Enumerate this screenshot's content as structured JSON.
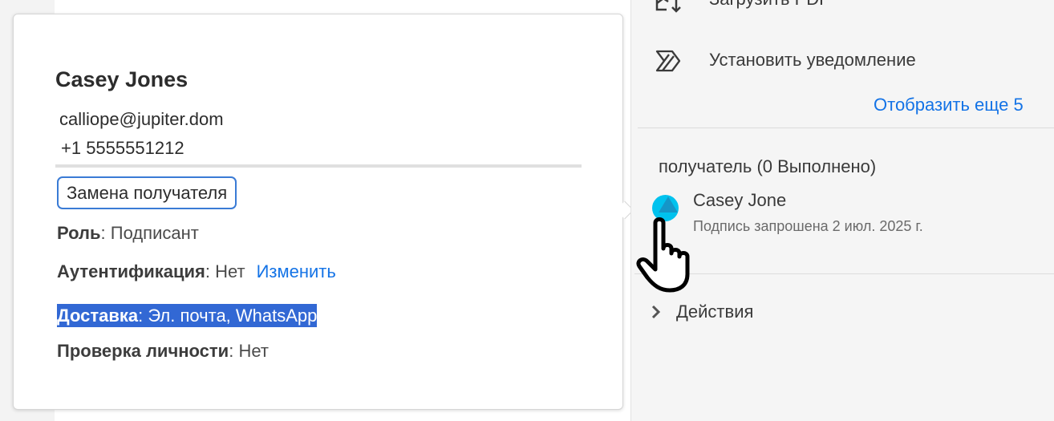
{
  "popover": {
    "name": "Casey Jones",
    "email": "calliope@jupiter.dom",
    "phone": "+1 5555551212",
    "replace_button": "Замена получателя",
    "role_label": "Роль",
    "role_value": "Подписант",
    "auth_label": "Аутентификация",
    "auth_value": "Нет",
    "auth_change": "Изменить",
    "delivery_label": "Доставка",
    "delivery_value": "Эл. почта, WhatsApp",
    "identity_label": "Проверка личности",
    "identity_value": "Нет"
  },
  "panel": {
    "download_pdf": "Загрузить PDF",
    "set_reminder": "Установить уведомление",
    "show_more": "Отобразить еще 5",
    "recipients_header": "получатель (0 Выполнено)",
    "recipient_name": "Casey Jone",
    "recipient_status": "Подпись запрошена 2 июл. 2025 г.",
    "actions": "Действия",
    "avatar_color": "#00c2ee",
    "link_color": "#1473e6"
  }
}
